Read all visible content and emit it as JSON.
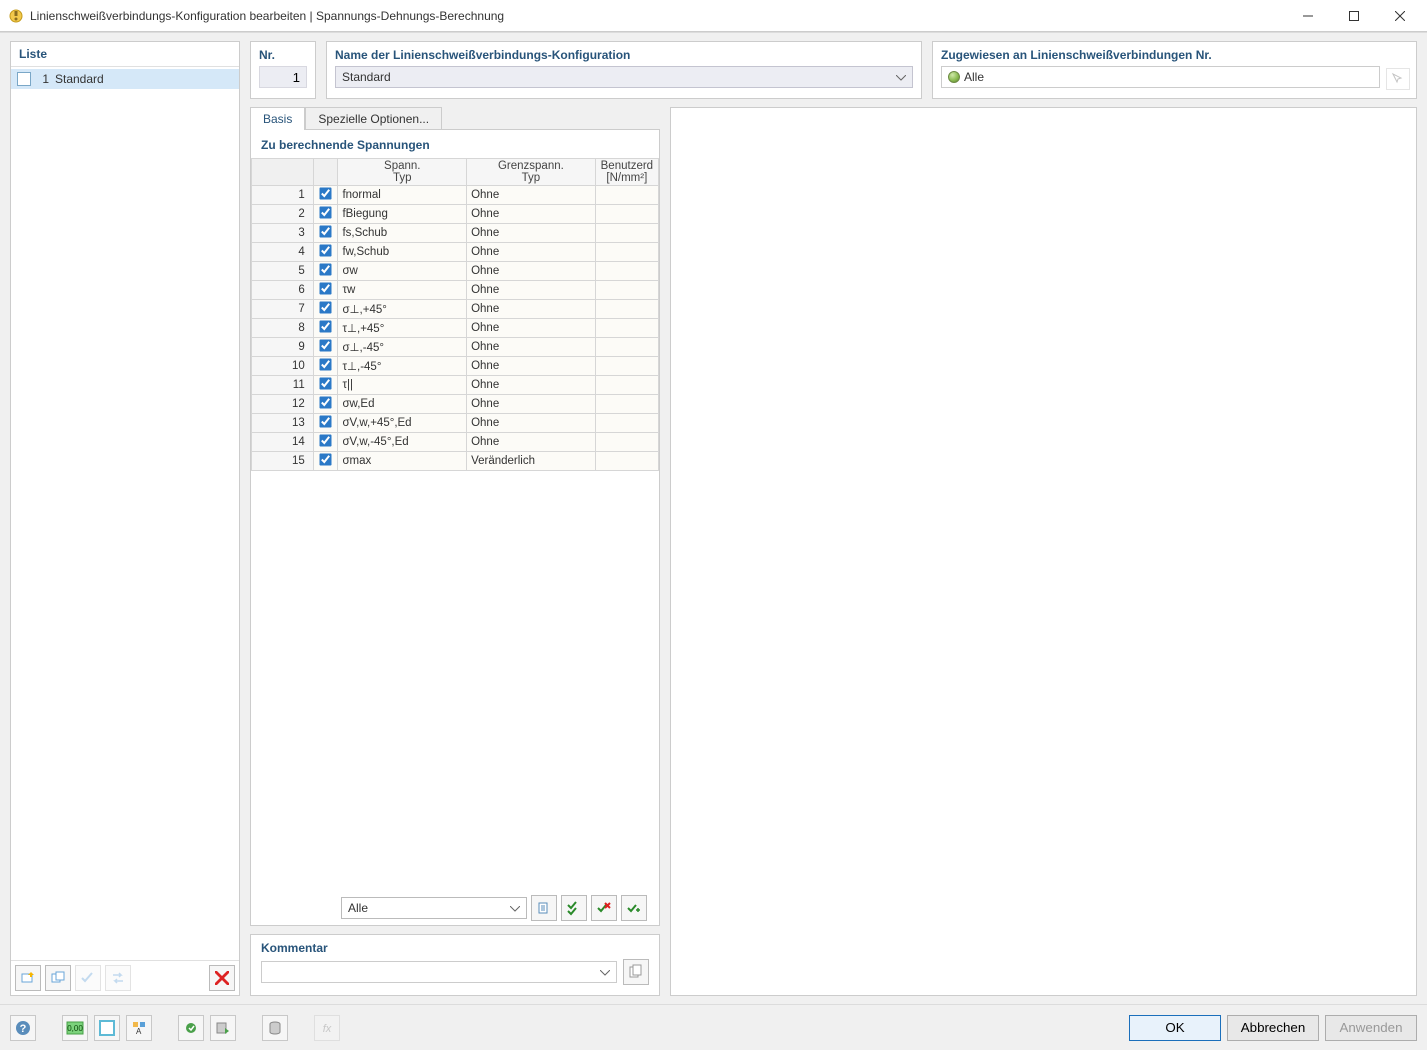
{
  "window": {
    "title": "Linienschweißverbindungs-Konfiguration bearbeiten | Spannungs-Dehnungs-Berechnung"
  },
  "sidebar": {
    "header": "Liste",
    "items": [
      {
        "num": "1",
        "label": "Standard"
      }
    ]
  },
  "top": {
    "nr_label": "Nr.",
    "nr_value": "1",
    "name_label": "Name der Linienschweißverbindungs-Konfiguration",
    "name_value": "Standard",
    "assigned_label": "Zugewiesen an Linienschweißverbindungen Nr.",
    "assigned_value": "Alle"
  },
  "tabs": {
    "basis": "Basis",
    "special": "Spezielle Optionen..."
  },
  "section_title": "Zu berechnende Spannungen",
  "columns": {
    "spann_typ_l1": "Spann.",
    "spann_typ_l2": "Typ",
    "grenz_l1": "Grenzspann.",
    "grenz_l2": "Typ",
    "user_l1": "Benutzerd",
    "user_l2": "[N/mm²]"
  },
  "rows": [
    {
      "n": "1",
      "chk": true,
      "typ": "fnormal",
      "grenz": "Ohne",
      "user": ""
    },
    {
      "n": "2",
      "chk": true,
      "typ": "fBiegung",
      "grenz": "Ohne",
      "user": ""
    },
    {
      "n": "3",
      "chk": true,
      "typ": "fs,Schub",
      "grenz": "Ohne",
      "user": ""
    },
    {
      "n": "4",
      "chk": true,
      "typ": "fw,Schub",
      "grenz": "Ohne",
      "user": ""
    },
    {
      "n": "5",
      "chk": true,
      "typ": "σw",
      "grenz": "Ohne",
      "user": ""
    },
    {
      "n": "6",
      "chk": true,
      "typ": "τw",
      "grenz": "Ohne",
      "user": ""
    },
    {
      "n": "7",
      "chk": true,
      "typ": "σ⊥,+45°",
      "grenz": "Ohne",
      "user": ""
    },
    {
      "n": "8",
      "chk": true,
      "typ": "τ⊥,+45°",
      "grenz": "Ohne",
      "user": ""
    },
    {
      "n": "9",
      "chk": true,
      "typ": "σ⊥,-45°",
      "grenz": "Ohne",
      "user": ""
    },
    {
      "n": "10",
      "chk": true,
      "typ": "τ⊥,-45°",
      "grenz": "Ohne",
      "user": ""
    },
    {
      "n": "11",
      "chk": true,
      "typ": "τ||",
      "grenz": "Ohne",
      "user": ""
    },
    {
      "n": "12",
      "chk": true,
      "typ": "σw,Ed",
      "grenz": "Ohne",
      "user": ""
    },
    {
      "n": "13",
      "chk": true,
      "typ": "σV,w,+45°,Ed",
      "grenz": "Ohne",
      "user": ""
    },
    {
      "n": "14",
      "chk": true,
      "typ": "σV,w,-45°,Ed",
      "grenz": "Ohne",
      "user": ""
    },
    {
      "n": "15",
      "chk": true,
      "typ": "σmax",
      "grenz": "Veränderlich",
      "user": ""
    }
  ],
  "footer_filter": "Alle",
  "comment": {
    "label": "Kommentar",
    "value": ""
  },
  "buttons": {
    "ok": "OK",
    "cancel": "Abbrechen",
    "apply": "Anwenden"
  }
}
